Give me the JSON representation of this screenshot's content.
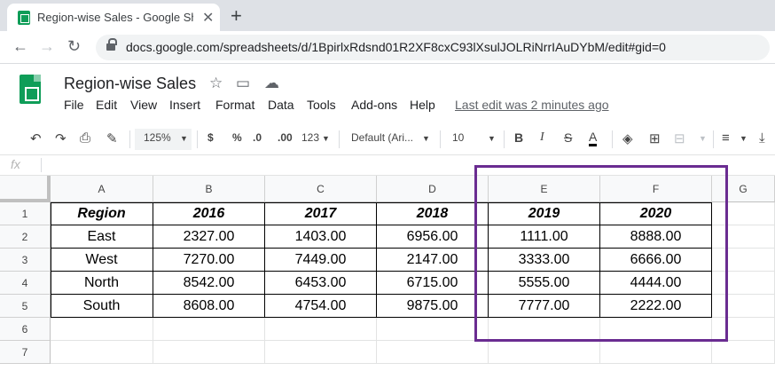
{
  "browser": {
    "tab_title": "Region-wise Sales - Google Shee",
    "tab_close": "✕",
    "new_tab": "+",
    "url": "docs.google.com/spreadsheets/d/1BpirlxRdsnd01R2XF8cxC93lXsulJOLRiNrrIAuDYbM/edit#gid=0"
  },
  "doc": {
    "title": "Region-wise Sales",
    "last_edit": "Last edit was 2 minutes ago"
  },
  "menu": [
    "File",
    "Edit",
    "View",
    "Insert",
    "Format",
    "Data",
    "Tools",
    "Add-ons",
    "Help"
  ],
  "toolbar": {
    "zoom": "125%",
    "currency": "$",
    "percent": "%",
    "decrease_decimal": ".0",
    "increase_decimal": ".00",
    "more_formats": "123",
    "font": "Default (Ari...",
    "font_size": "10",
    "bold": "B",
    "italic": "I",
    "strike": "S",
    "text_color": "A"
  },
  "formula_bar": {
    "fx": "fx"
  },
  "grid": {
    "columns": [
      "A",
      "B",
      "C",
      "D",
      "E",
      "F",
      "G"
    ],
    "rows": [
      "1",
      "2",
      "3",
      "4",
      "5",
      "6",
      "7"
    ],
    "cells": [
      [
        "Region",
        "2016",
        "2017",
        "2018",
        "2019",
        "2020"
      ],
      [
        "East",
        "2327.00",
        "1403.00",
        "6956.00",
        "1111.00",
        "8888.00"
      ],
      [
        "West",
        "7270.00",
        "7449.00",
        "2147.00",
        "3333.00",
        "6666.00"
      ],
      [
        "North",
        "8542.00",
        "6453.00",
        "6715.00",
        "5555.00",
        "4444.00"
      ],
      [
        "South",
        "8608.00",
        "4754.00",
        "9875.00",
        "7777.00",
        "2222.00"
      ]
    ]
  },
  "colors": {
    "highlight": "#6a2c91",
    "sheets_green": "#0f9d58"
  }
}
